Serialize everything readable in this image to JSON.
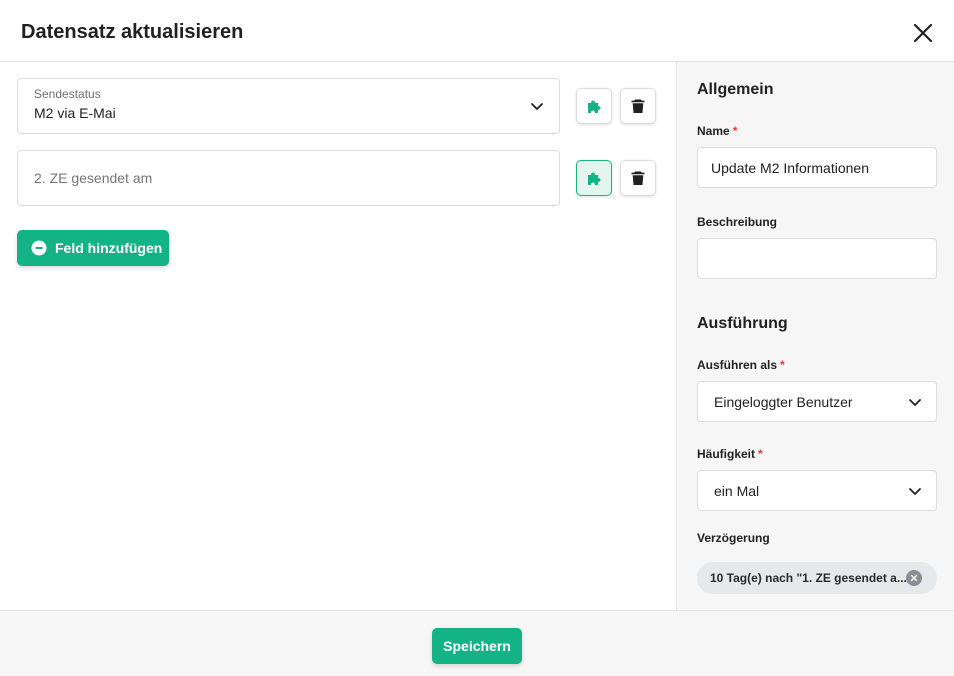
{
  "dialog": {
    "title": "Datensatz aktualisieren",
    "close_icon": "close-icon"
  },
  "fields": [
    {
      "label": "Sendestatus",
      "value": "M2 via E-Mai",
      "plugin_active": false
    },
    {
      "placeholder": "2. ZE gesendet am",
      "plugin_active": true
    }
  ],
  "add_field_label": "Feld hinzufügen",
  "sidebar": {
    "general": {
      "title": "Allgemein",
      "name_label": "Name",
      "name_value": "Update M2 Informationen",
      "description_label": "Beschreibung",
      "description_value": ""
    },
    "execution": {
      "title": "Ausführung",
      "run_as_label": "Ausführen als",
      "run_as_value": "Eingeloggter Benutzer",
      "frequency_label": "Häufigkeit",
      "frequency_value": "ein Mal",
      "delay_label": "Verzögerung",
      "delay_chip": "10 Tag(e) nach \"1. ZE gesendet a..."
    },
    "required_marker": "*"
  },
  "footer": {
    "save_label": "Speichern"
  },
  "colors": {
    "accent": "#13b386",
    "required": "#e23b3b"
  }
}
